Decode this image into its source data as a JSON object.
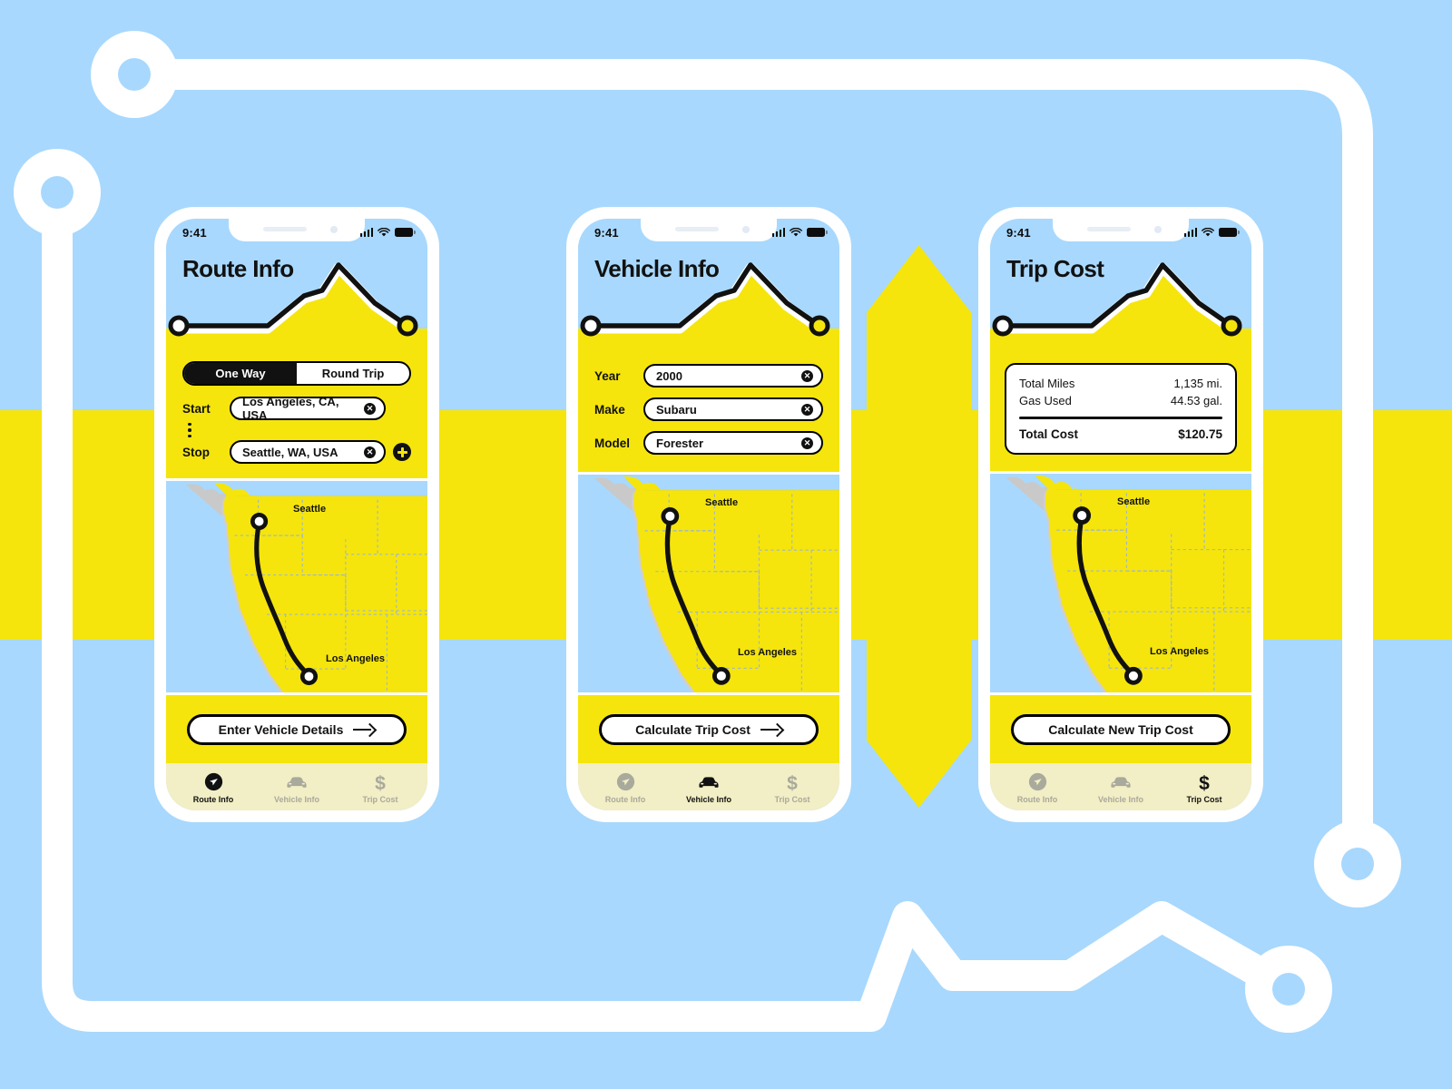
{
  "theme": {
    "background_blue": "#a8d8fd",
    "accent_yellow": "#f5e50c",
    "tabbar_cream": "#f2eec5",
    "ink": "#111111",
    "white": "#ffffff",
    "inactive_gray": "#a9a99c"
  },
  "status_bar": {
    "time": "9:41",
    "signal_icon": "cellular-signal-icon",
    "wifi_icon": "wifi-icon",
    "battery_icon": "battery-icon"
  },
  "screens": [
    {
      "id": "route-info",
      "title": "Route Info",
      "trip_type": {
        "options": [
          "One Way",
          "Round Trip"
        ],
        "selected": "One Way"
      },
      "fields": [
        {
          "label": "Start",
          "value": "Los Angeles, CA, USA",
          "clear_icon": "clear-circle-icon"
        },
        {
          "label": "Stop",
          "value": "Seattle, WA, USA",
          "clear_icon": "clear-circle-icon"
        }
      ],
      "add_stop_icon": "plus-circle-icon",
      "cta": {
        "label": "Enter Vehicle Details",
        "has_arrow": true,
        "arrow_icon": "arrow-right-icon"
      },
      "active_tab": "Route Info"
    },
    {
      "id": "vehicle-info",
      "title": "Vehicle Info",
      "fields": [
        {
          "label": "Year",
          "value": "2000",
          "clear_icon": "clear-circle-icon"
        },
        {
          "label": "Make",
          "value": "Subaru",
          "clear_icon": "clear-circle-icon"
        },
        {
          "label": "Model",
          "value": "Forester",
          "clear_icon": "clear-circle-icon"
        }
      ],
      "cta": {
        "label": "Calculate Trip Cost",
        "has_arrow": true,
        "arrow_icon": "arrow-right-icon"
      },
      "active_tab": "Vehicle Info"
    },
    {
      "id": "trip-cost",
      "title": "Trip Cost",
      "summary": [
        {
          "label": "Total Miles",
          "value": "1,135 mi."
        },
        {
          "label": "Gas Used",
          "value": "44.53 gal."
        }
      ],
      "total": {
        "label": "Total Cost",
        "value": "$120.75"
      },
      "cta": {
        "label": "Calculate New Trip Cost",
        "has_arrow": false
      },
      "active_tab": "Trip Cost"
    }
  ],
  "map": {
    "origin_label": "Los Angeles",
    "destination_label": "Seattle",
    "origin_marker_icon": "map-pin-circle-icon",
    "destination_marker_icon": "map-pin-circle-icon"
  },
  "tabs": [
    {
      "label": "Route Info",
      "icon": "navigation-arrow-icon"
    },
    {
      "label": "Vehicle Info",
      "icon": "car-icon"
    },
    {
      "label": "Trip Cost",
      "icon": "dollar-sign-icon"
    }
  ]
}
